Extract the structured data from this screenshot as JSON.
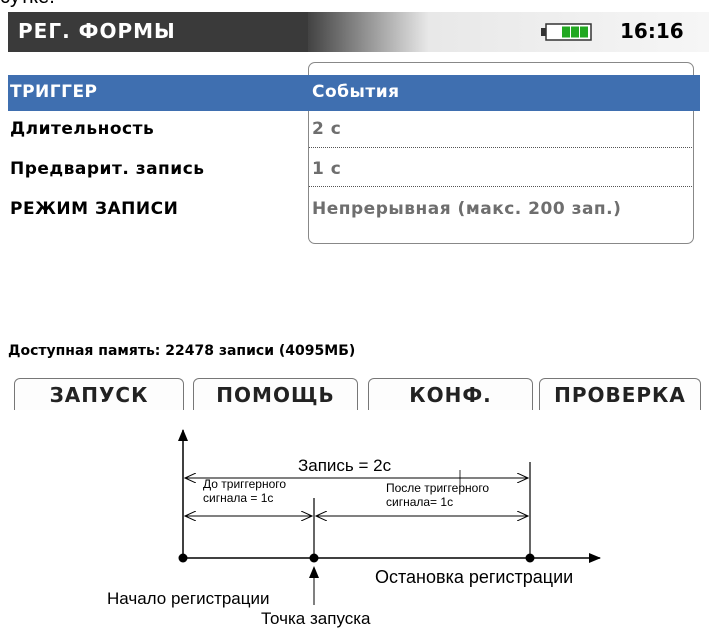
{
  "screen": {
    "title": "РЕГ. ФОРМЫ",
    "clock": "16:16",
    "rows": [
      {
        "label": "ТРИГГЕР",
        "value": "События",
        "selected": true
      },
      {
        "label": "Длительность",
        "value": "2 с"
      },
      {
        "label": "Предварит. запись",
        "value": "1 с"
      },
      {
        "label": "РЕЖИМ ЗАПИСИ",
        "value": "Непрерывная (макс. 200 зап.)"
      }
    ],
    "memory_text": "Доступная память: 22478 записи (4095МБ)",
    "function_keys": [
      "ЗАПУСК",
      "ПОМОЩЬ",
      "КОНФ.",
      "ПРОВЕРКА"
    ]
  },
  "diagram": {
    "record_label": "Запись = 2с",
    "pre_trigger_label": "До триггерного\nсигнала = 1с",
    "post_trigger_label": "После триггерного\nсигнала= 1с",
    "stop_label": "Остановка регистрации",
    "start_label": "Начало регистрации",
    "trigger_label": "Точка запуска"
  },
  "colors": {
    "title_bar": "#3a3a3a",
    "selected_row": "#3f6fb0",
    "battery": "#22a822",
    "value_text": "#6e6e6e"
  }
}
